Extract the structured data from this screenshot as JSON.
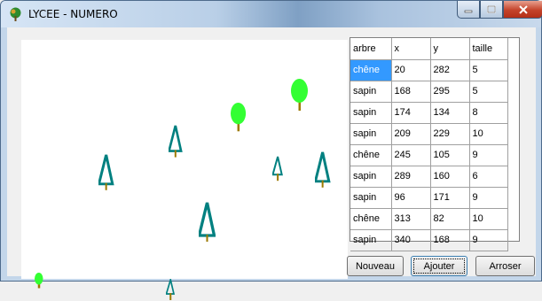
{
  "window": {
    "title": "LYCEE - NUMERO"
  },
  "grid": {
    "columns": [
      "arbre",
      "x",
      "y",
      "taille"
    ],
    "rows": [
      [
        "chêne",
        "20",
        "282",
        "5"
      ],
      [
        "sapin",
        "168",
        "295",
        "5"
      ],
      [
        "sapin",
        "174",
        "134",
        "8"
      ],
      [
        "sapin",
        "209",
        "229",
        "10"
      ],
      [
        "chêne",
        "245",
        "105",
        "9"
      ],
      [
        "sapin",
        "289",
        "160",
        "6"
      ],
      [
        "sapin",
        "96",
        "171",
        "9"
      ],
      [
        "chêne",
        "313",
        "82",
        "10"
      ],
      [
        "sapin",
        "340",
        "168",
        "9"
      ]
    ]
  },
  "buttons": {
    "nouveau": "Nouveau",
    "ajouter": "Ajouter",
    "arroser": "Arroser"
  },
  "colors": {
    "sapin": "#008080",
    "chene_foliage": "#33ff33",
    "trunk": "#9c7a00",
    "selection": "#3399ff"
  },
  "icons": [
    "app-tree-icon",
    "minimize-icon",
    "maximize-icon",
    "close-icon"
  ]
}
